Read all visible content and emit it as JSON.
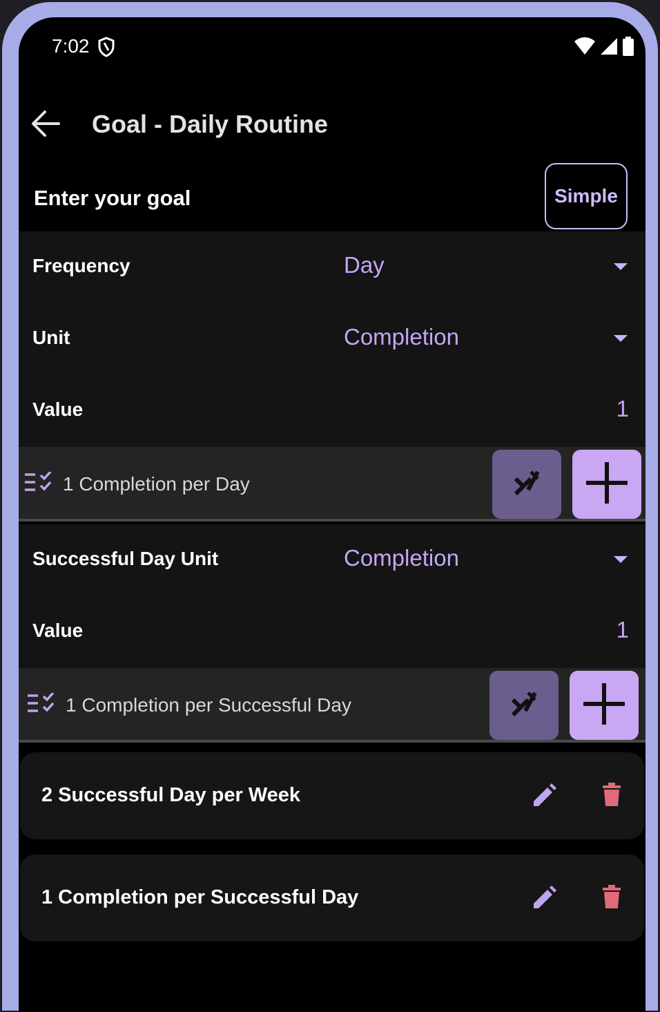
{
  "status_bar": {
    "time": "7:02"
  },
  "header": {
    "title": "Goal - Daily Routine"
  },
  "goal": {
    "label": "Enter your goal",
    "mode_button": "Simple"
  },
  "goal_settings": {
    "frequency": {
      "label": "Frequency",
      "value": "Day"
    },
    "unit": {
      "label": "Unit",
      "value": "Completion"
    },
    "value": {
      "label": "Value",
      "value": "1"
    },
    "summary": "1 Completion per Day"
  },
  "successful_day": {
    "unit": {
      "label": "Successful Day Unit",
      "value": "Completion"
    },
    "value": {
      "label": "Value",
      "value": "1"
    },
    "summary": "1 Completion per Successful Day"
  },
  "goals_list": [
    {
      "text": "2 Successful Day per Week"
    },
    {
      "text": "1 Completion per Successful Day"
    }
  ],
  "colors": {
    "accent": "#c4a6f5",
    "frame": "#a7ace8",
    "delete": "#e06a78",
    "clear_button": "#6b5e8e",
    "add_button": "#c8a8f3"
  },
  "icons": [
    "shield-icon",
    "wifi-icon",
    "signal-icon",
    "battery-icon",
    "back-arrow-icon",
    "dropdown-caret-icon",
    "checklist-icon",
    "clear-icon",
    "plus-icon",
    "edit-icon",
    "delete-icon"
  ]
}
